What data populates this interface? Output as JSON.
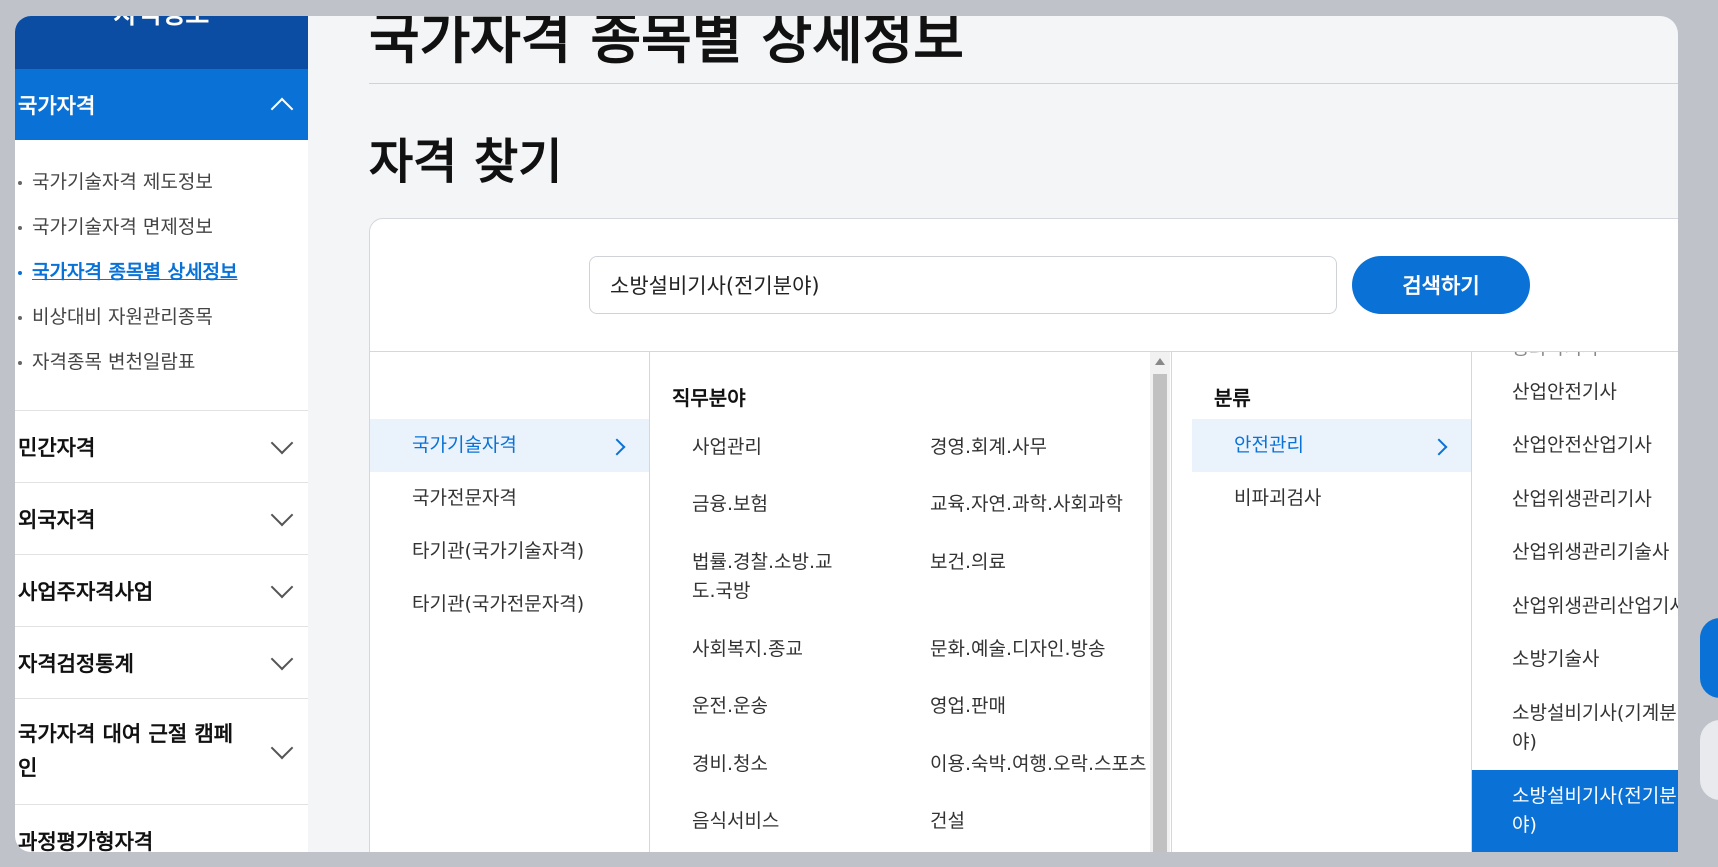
{
  "sidebar": {
    "header": "자격정보",
    "active_section": "국가자격",
    "sub_items": [
      {
        "label": "국가기술자격 제도정보"
      },
      {
        "label": "국가기술자격 면제정보"
      },
      {
        "label": "국가자격 종목별 상세정보"
      },
      {
        "label": "비상대비 자원관리종목"
      },
      {
        "label": "자격종목 변천일람표"
      }
    ],
    "sections": [
      {
        "label": "민간자격"
      },
      {
        "label": "외국자격"
      },
      {
        "label": "사업주자격사업"
      },
      {
        "label": "자격검정통계"
      },
      {
        "label": "국가자격 대여 근절 캠페인"
      },
      {
        "label": "과정평가형자격"
      }
    ]
  },
  "main": {
    "page_title": "국가자격 종목별 상세정보",
    "section_title": "자격 찾기",
    "search": {
      "value": "소방설비기사(전기분야)",
      "button": "검색하기"
    },
    "col1": {
      "items": [
        {
          "label": "국가기술자격"
        },
        {
          "label": "국가전문자격"
        },
        {
          "label": "타기관(국가기술자격)"
        },
        {
          "label": "타기관(국가전문자격)"
        }
      ]
    },
    "col2": {
      "heading": "직무분야",
      "items": [
        {
          "label": "사업관리"
        },
        {
          "label": "경영.회계.사무"
        },
        {
          "label": "금융.보험"
        },
        {
          "label": "교육.자연.과학.사회과학"
        },
        {
          "label": "법률.경찰.소방.교도.국방"
        },
        {
          "label": "보건.의료"
        },
        {
          "label": "사회복지.종교"
        },
        {
          "label": "문화.예술.디자인.방송"
        },
        {
          "label": "운전.운송"
        },
        {
          "label": "영업.판매"
        },
        {
          "label": "경비.청소"
        },
        {
          "label": "이용.숙박.여행.오락.스포츠"
        },
        {
          "label": "음식서비스"
        },
        {
          "label": "건설"
        }
      ]
    },
    "col3": {
      "heading": "분류",
      "items": [
        {
          "label": "안전관리"
        },
        {
          "label": "비파괴검사"
        }
      ]
    },
    "col4": {
      "items": [
        {
          "label": "농화학기사"
        },
        {
          "label": "산업안전기사"
        },
        {
          "label": "산업안전산업기사"
        },
        {
          "label": "산업위생관리기사"
        },
        {
          "label": "산업위생관리기술사"
        },
        {
          "label": "산업위생관리산업기사"
        },
        {
          "label": "소방기술사"
        },
        {
          "label": "소방설비기사(기계분야)"
        },
        {
          "label": "소방설비기사(전기분야)"
        }
      ]
    }
  },
  "colors": {
    "brand_dark": "#0a4da2",
    "brand": "#0a72d6",
    "selected_bg": "#eaf3fc"
  }
}
